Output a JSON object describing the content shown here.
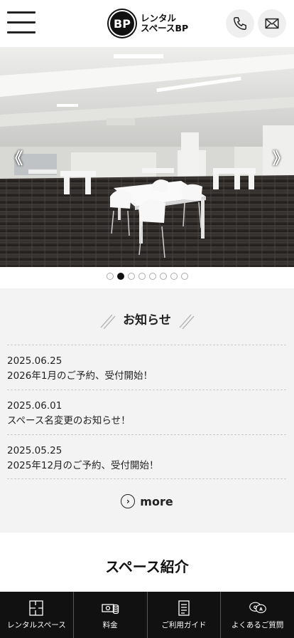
{
  "header": {
    "logo_mark": "BP",
    "logo_line1": "レンタル",
    "logo_line2": "スペースBP"
  },
  "hero": {
    "prev_arrow": "《",
    "next_arrow": "》",
    "slide_count": 8,
    "active_slide": 2
  },
  "news": {
    "title": "お知らせ",
    "items": [
      {
        "date": "2025.06.25",
        "text": "2026年1月のご予約、受付開始！"
      },
      {
        "date": "2025.06.01",
        "text": "スペース名変更のお知らせ！"
      },
      {
        "date": "2025.05.25",
        "text": "2025年12月のご予約、受付開始！"
      }
    ],
    "more_label": "more"
  },
  "space": {
    "title": "スペース紹介"
  },
  "bottom_nav": [
    {
      "label": "レンタルスペース",
      "icon": "floorplan-icon"
    },
    {
      "label": "料金",
      "icon": "money-icon"
    },
    {
      "label": "ご利用ガイド",
      "icon": "guide-icon"
    },
    {
      "label": "よくあるご質問",
      "icon": "faq-icon"
    }
  ],
  "colors": {
    "nav_bg": "#111111",
    "news_bg": "#f3f3f3",
    "active_dot": "#111111"
  }
}
